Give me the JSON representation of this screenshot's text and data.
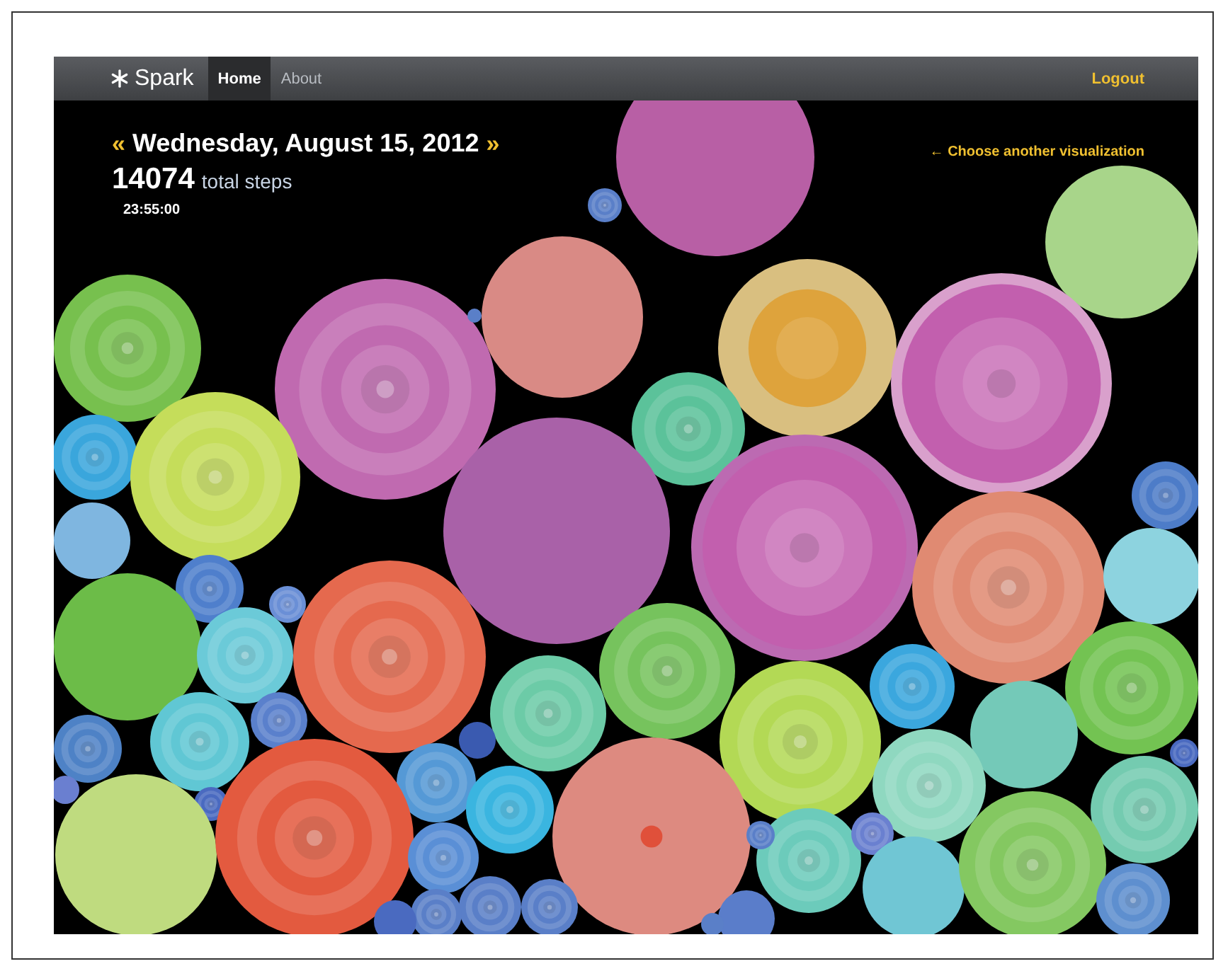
{
  "navbar": {
    "brand": "Spark",
    "items": [
      {
        "label": "Home",
        "selected": true
      },
      {
        "label": "About",
        "selected": false
      }
    ],
    "logout": "Logout"
  },
  "day": {
    "prev": "«",
    "date": "Wednesday, August 15, 2012",
    "next": "»",
    "steps": "14074",
    "steps_label": "total steps",
    "time": "23:55:00"
  },
  "visualization_link": "← Choose another visualization"
}
